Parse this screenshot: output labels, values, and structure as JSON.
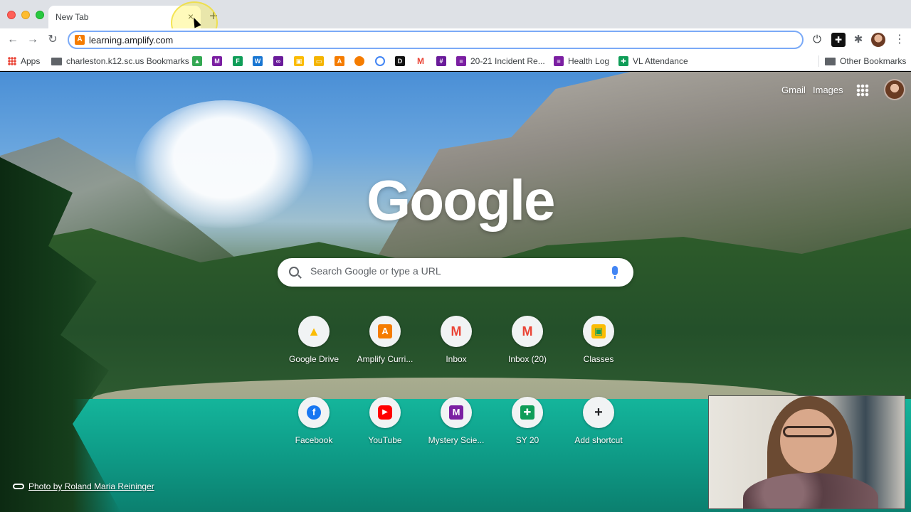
{
  "tab": {
    "title": "New Tab",
    "close_glyph": "×",
    "new_tab_glyph": "+"
  },
  "toolbar": {
    "back_glyph": "←",
    "forward_glyph": "→",
    "reload_glyph": "↻",
    "url": "learning.amplify.com",
    "site_icon_letter": "A",
    "power_glyph": "⏻",
    "puzzle_glyph": "✱",
    "menu_glyph": "⋮"
  },
  "bookmarks": {
    "apps": "Apps",
    "folder1": "charleston.k12.sc.us Bookmarks",
    "incident": "20-21 Incident Re...",
    "health": "Health Log",
    "attendance": "VL Attendance",
    "other": "Other Bookmarks",
    "icon_colors": [
      "#34a853",
      "#7b1fa2",
      "#0f9d58",
      "#1976d2",
      "#6a1b9a",
      "#fbbc04",
      "#f4b400",
      "#f57c00",
      "#f57c00",
      "#4285f4",
      "#111111",
      "#ea4335",
      "#6a1b9a"
    ]
  },
  "ntp": {
    "gmail": "Gmail",
    "images": "Images",
    "logo": "Google",
    "search_placeholder": "Search Google or type a URL",
    "photo_credit": "Photo by Roland Maria Reininger",
    "shortcuts_row1": [
      {
        "label": "Google Drive",
        "icon": "google-drive-icon"
      },
      {
        "label": "Amplify Curri...",
        "icon": "amplify-icon"
      },
      {
        "label": "Inbox",
        "icon": "gmail-icon"
      },
      {
        "label": "Inbox (20)",
        "icon": "gmail-icon"
      },
      {
        "label": "Classes",
        "icon": "classroom-icon"
      }
    ],
    "shortcuts_row2": [
      {
        "label": "Facebook",
        "icon": "facebook-icon"
      },
      {
        "label": "YouTube",
        "icon": "youtube-icon"
      },
      {
        "label": "Mystery Scie...",
        "icon": "mystery-science-icon"
      },
      {
        "label": "SY 20",
        "icon": "sheets-icon"
      },
      {
        "label": "Add shortcut",
        "icon": "plus-icon"
      }
    ]
  }
}
